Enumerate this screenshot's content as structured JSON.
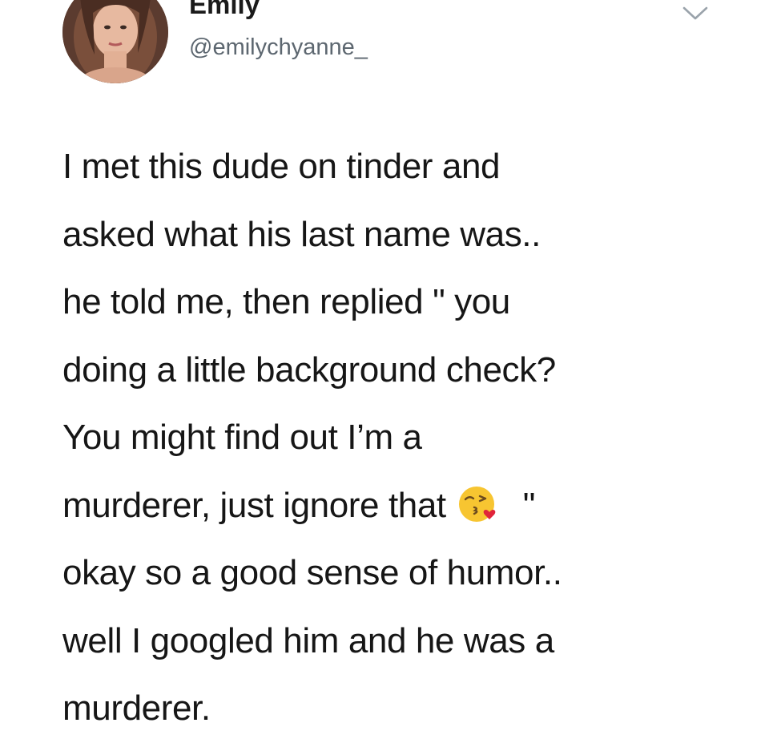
{
  "header": {
    "display_name": "Emily",
    "handle": "@emilychyanne_"
  },
  "icons": {
    "avatar": "profile-photo",
    "menu": "chevron-down-icon",
    "emoji": "face-blowing-a-kiss"
  },
  "tweet": {
    "lines": [
      "I met this dude on tinder and",
      "asked what his last name was..",
      "he told me, then replied \" you",
      "doing a little background check?",
      "You might find out I’m a",
      "murderer, just ignore that",
      "okay so a good sense of humor..",
      "well I googled him and he was a",
      "murderer."
    ],
    "line6_closing_quote": "\""
  },
  "colors": {
    "text": "#161616",
    "handle": "#5d6770",
    "chevron": "#9aa3ab",
    "emoji_face": "#f7c531",
    "emoji_heart": "#e0243a"
  }
}
